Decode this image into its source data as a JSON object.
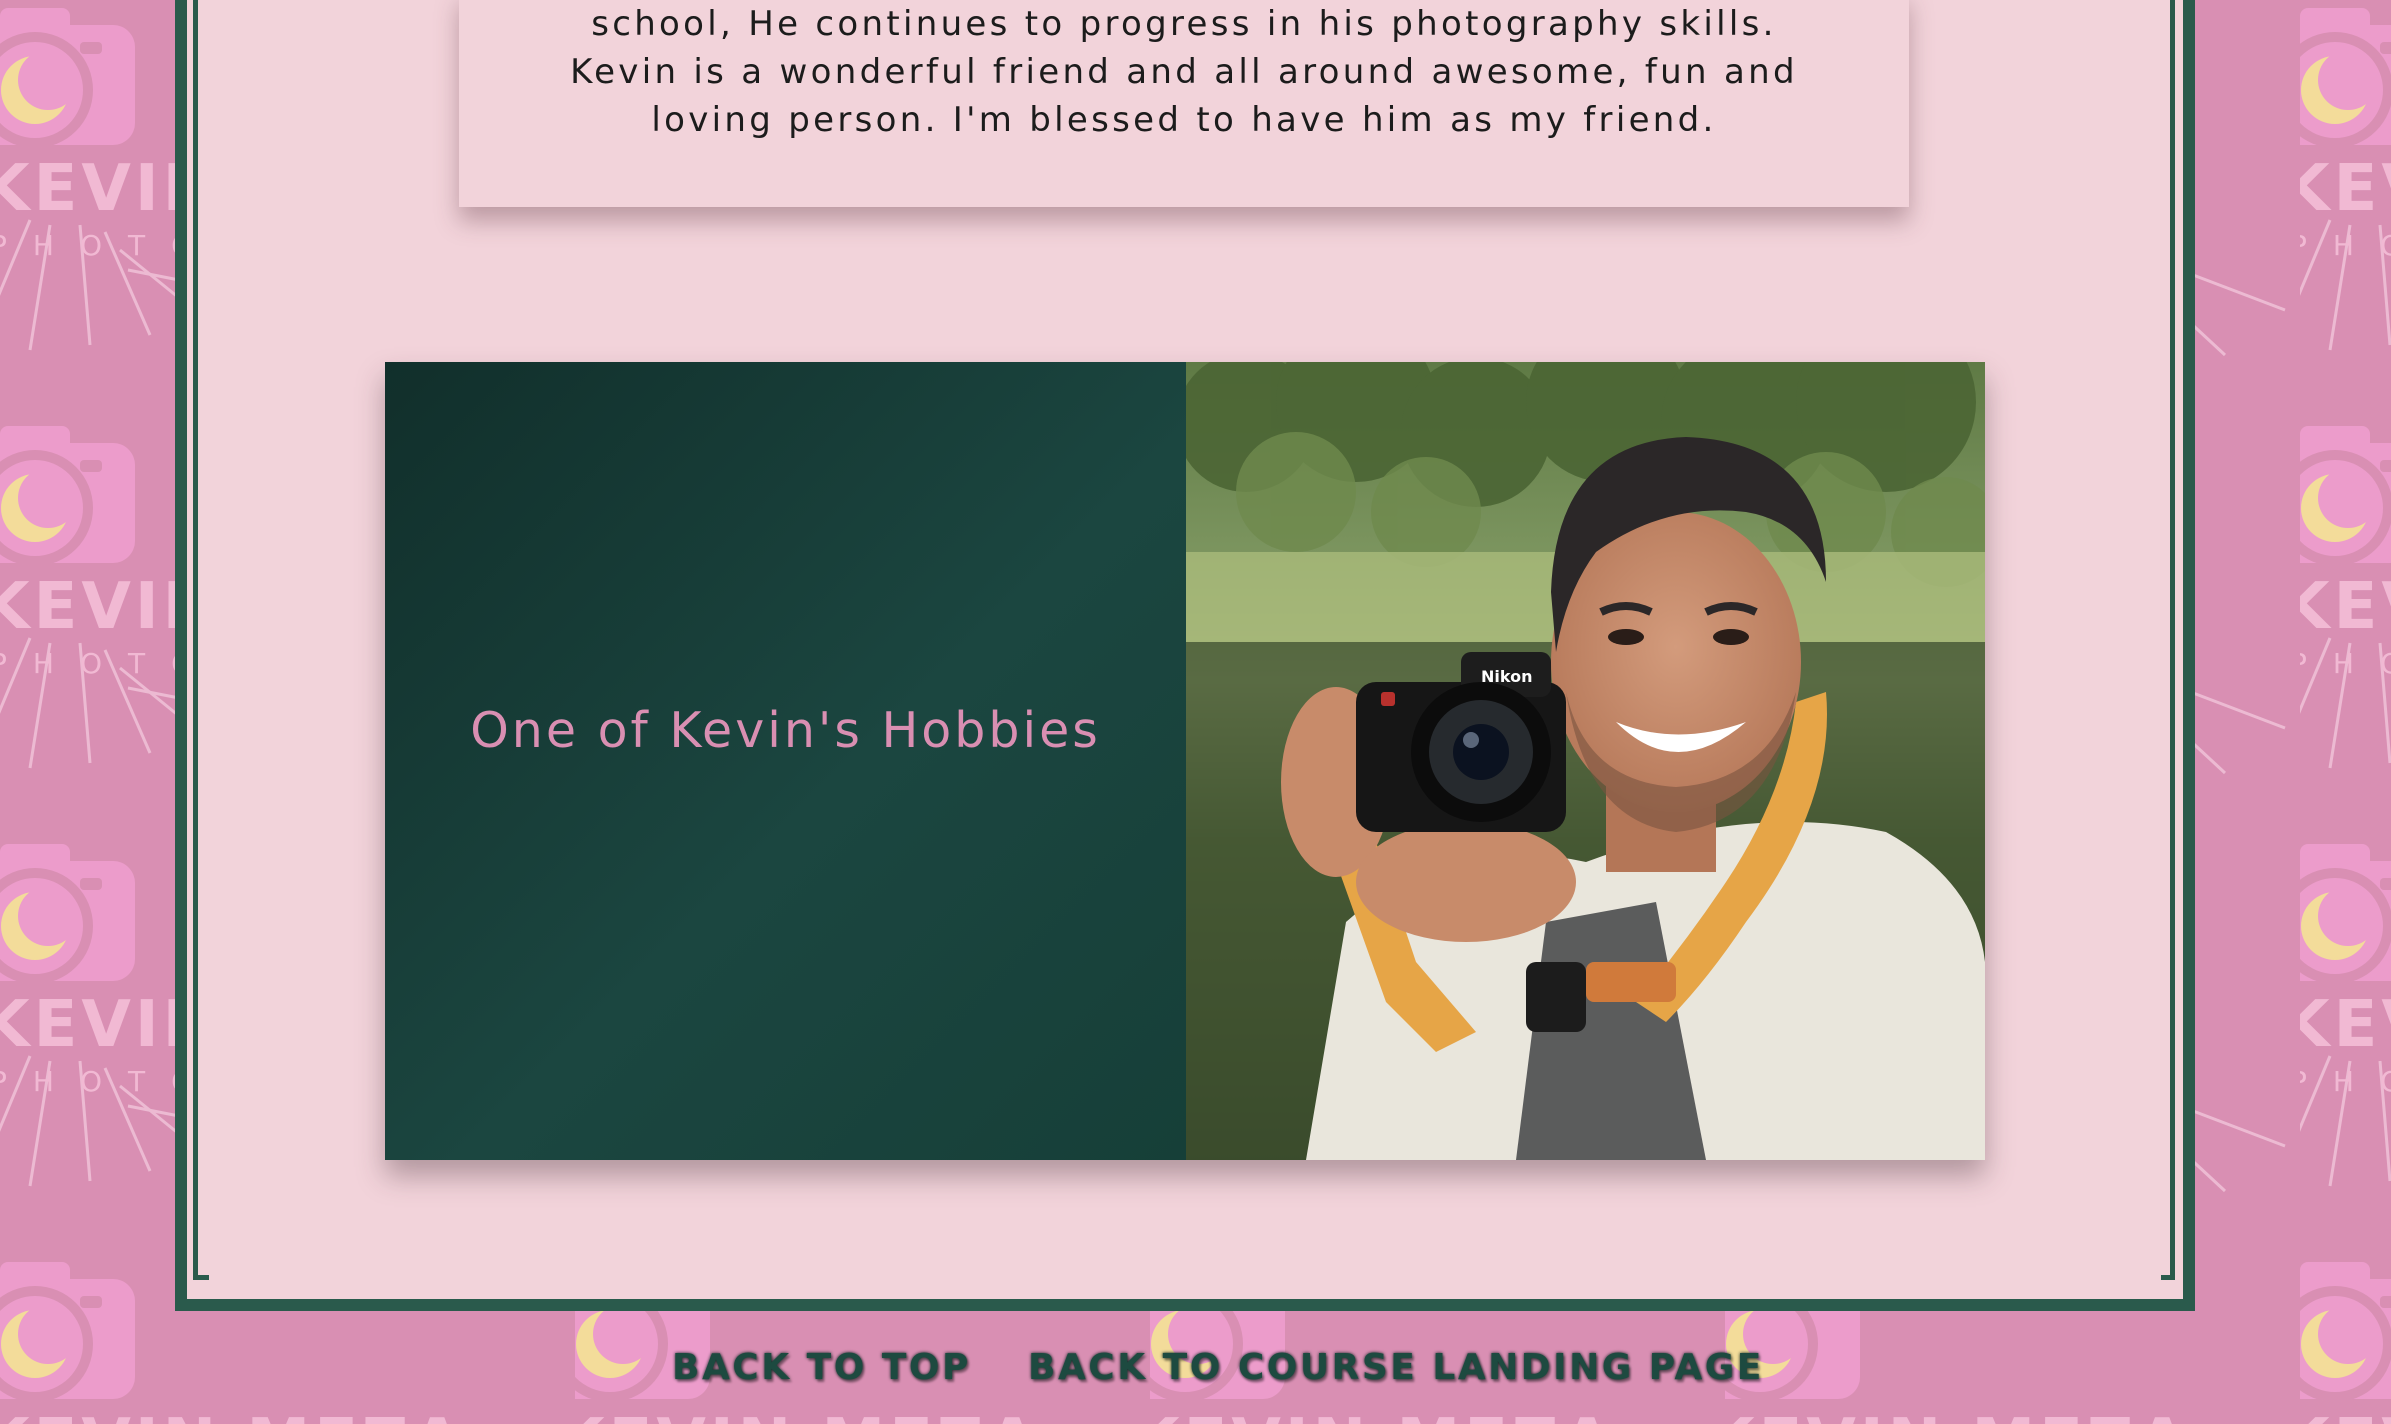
{
  "background": {
    "brand_text": "KEVIN MEZA",
    "brand_subtext": "PHOTOGRAPHY",
    "pattern_icon": "camera-icon",
    "colors": {
      "pink": "#d98fb3",
      "camera": "#ec9ccb",
      "lens_cream": "#f3dc9a",
      "panel": "#f2d3da",
      "dark_green": "#2a5a4c"
    }
  },
  "testimonial": {
    "lines": [
      "school, He continues to progress in his photography skills.",
      "Kevin is a wonderful friend and all around awesome, fun and",
      "loving person. I'm blessed to have him as my friend."
    ]
  },
  "feature": {
    "title": "One of Kevin's Hobbies",
    "photo_icon": "photographer-photo"
  },
  "footer": {
    "back_to_top": "BACK TO TOP",
    "back_to_course": "BACK TO COURSE LANDING PAGE"
  }
}
